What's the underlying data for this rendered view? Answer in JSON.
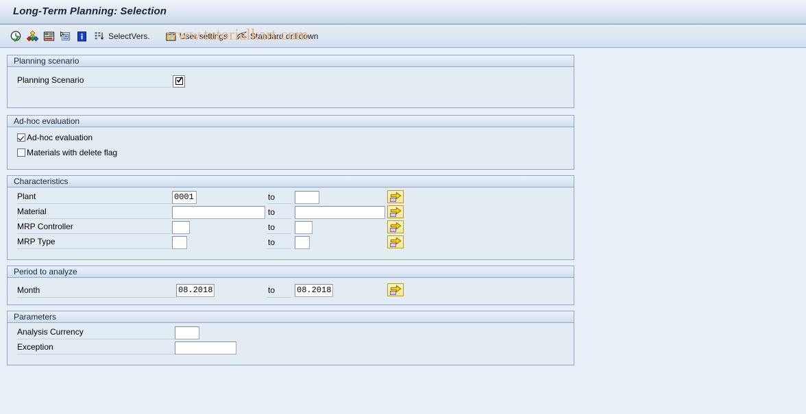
{
  "window": {
    "title": "Long-Term Planning: Selection"
  },
  "watermark": {
    "text": "www.tutorialkart.com",
    "color": "#eab27a"
  },
  "toolbar": {
    "buttons": [
      {
        "icon": "execute-clock-icon",
        "label": ""
      },
      {
        "icon": "multicolor-diamond-icon",
        "label": ""
      },
      {
        "icon": "report-list-icon",
        "label": ""
      },
      {
        "icon": "select-block-icon",
        "label": ""
      },
      {
        "icon": "information-icon",
        "label": ""
      },
      {
        "icon": "select-versions-icon",
        "label": "SelectVers."
      },
      {
        "icon": "user-settings-icon",
        "label": "User settings"
      },
      {
        "icon": "standard-drilldown-icon",
        "label": "Standard drilldown"
      }
    ]
  },
  "sections": {
    "planning_scenario": {
      "title": "Planning scenario",
      "field_label": "Planning Scenario",
      "field_value": ""
    },
    "adhoc": {
      "title": "Ad-hoc evaluation",
      "checkboxes": [
        {
          "label": "Ad-hoc evaluation",
          "checked": true
        },
        {
          "label": "Materials with delete flag",
          "checked": false
        }
      ]
    },
    "characteristics": {
      "title": "Characteristics",
      "to_label": "to",
      "rows": [
        {
          "label": "Plant",
          "from": "0001",
          "to": ""
        },
        {
          "label": "Material",
          "from": "",
          "to": ""
        },
        {
          "label": "MRP Controller",
          "from": "",
          "to": ""
        },
        {
          "label": "MRP Type",
          "from": "",
          "to": ""
        }
      ]
    },
    "period": {
      "title": "Period to analyze",
      "to_label": "to",
      "rows": [
        {
          "label": "Month",
          "from": "08.2018",
          "to": "08.2018"
        }
      ]
    },
    "parameters": {
      "title": "Parameters",
      "rows": [
        {
          "label": "Analysis Currency",
          "value": ""
        },
        {
          "label": "Exception",
          "value": ""
        }
      ]
    }
  }
}
